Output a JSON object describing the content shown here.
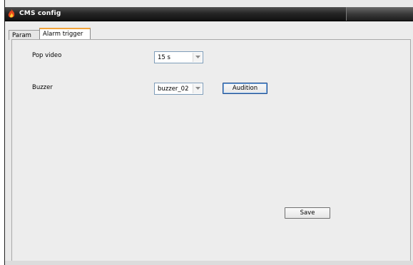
{
  "window": {
    "title": "CMS config",
    "icon": "app-flame-icon"
  },
  "tabs": [
    {
      "label": "Param",
      "active": false
    },
    {
      "label": "Alarm trigger",
      "active": true
    }
  ],
  "alarm_trigger": {
    "pop_video": {
      "label": "Pop video",
      "value": "15 s"
    },
    "buzzer": {
      "label": "Buzzer",
      "value": "buzzer_02"
    },
    "audition_button": "Audition",
    "save_button": "Save"
  },
  "colors": {
    "titlebar": "#1a1a1a",
    "active_tab_accent": "#f2a43a",
    "panel_bg": "#ededed"
  }
}
